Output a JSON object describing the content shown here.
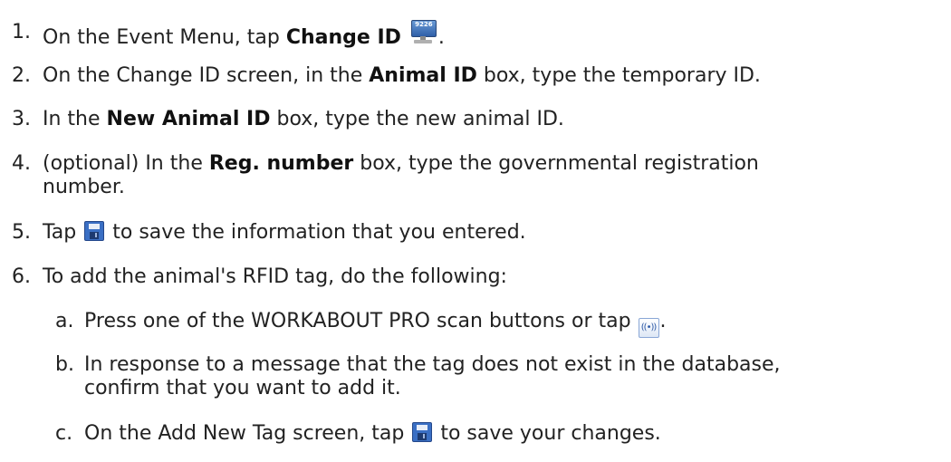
{
  "steps": [
    {
      "num": "1.",
      "pre": "On the Event Menu, tap ",
      "bold": "Change ID",
      "icon": "change-id-icon",
      "post": "."
    },
    {
      "num": "2.",
      "pre": "On the Change ID screen, in the ",
      "bold": "Animal ID",
      "post": " box, type the temporary ID."
    },
    {
      "num": "3.",
      "pre": "In the ",
      "bold": "New Animal ID",
      "post": " box, type the new animal ID."
    },
    {
      "num": "4.",
      "pre": "(optional) In the ",
      "bold": "Reg. number",
      "post": " box, type the governmental registration",
      "line2": "number."
    },
    {
      "num": "5.",
      "pre": "Tap ",
      "icon": "save-icon",
      "post": " to save the information that you entered."
    },
    {
      "num": "6.",
      "text": "To add the animal's RFID tag, do the following:"
    }
  ],
  "substeps": [
    {
      "num": "a.",
      "pre": "Press one of the WORKABOUT PRO scan buttons or tap ",
      "icon": "scan-icon",
      "post": "."
    },
    {
      "num": "b.",
      "line1": "In response to a message that the tag does not exist in the database,",
      "line2": "confirm that you want to add it."
    },
    {
      "num": "c.",
      "pre": "On the Add New Tag screen, tap ",
      "icon": "save-icon",
      "post": " to save your changes."
    }
  ],
  "icons": {
    "change_id_screen_text": "9226",
    "scan_glyph": "((•))"
  },
  "colors": {
    "text": "#222222",
    "icon_blue": "#3a6fc4"
  }
}
